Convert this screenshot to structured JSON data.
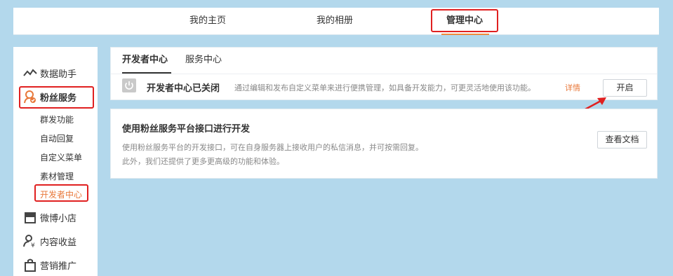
{
  "topnav": {
    "home": "我的主页",
    "album": "我的相册",
    "admin": "管理中心"
  },
  "sidebar": {
    "data_assistant": "数据助手",
    "fans_service": "粉丝服务",
    "fans_sub": [
      "群发功能",
      "自动回复",
      "自定义菜单",
      "素材管理",
      "开发者中心"
    ],
    "weibo_shop": "微博小店",
    "content_income": "内容收益",
    "marketing": "营销推广"
  },
  "panel1": {
    "tab_dev": "开发者中心",
    "tab_service": "服务中心",
    "dev_status": "开发者中心已关闭",
    "dev_desc": "通过编辑和发布自定义菜单来进行便携管理，如具备开发能力，可更灵活地使用该功能。",
    "dev_link": "详情",
    "open_button": "开启"
  },
  "panel2": {
    "title": "使用粉丝服务平台接口进行开发",
    "desc": "使用粉丝服务平台的开发接口，可在自身服务器上接收用户的私信消息，并可按需回复。此外，我们还提供了更多更高级的功能和体验。",
    "doc_button": "查看文档"
  },
  "colors": {
    "background": "#b3d8ec",
    "highlight_red": "#e02020",
    "link_orange": "#e8783a",
    "active_sidebar": "#e8783a"
  },
  "icons": [
    "chart-line-icon",
    "fans-service-icon",
    "shop-icon",
    "person-yen-icon",
    "bag-icon",
    "power-icon",
    "arrow-annotation"
  ]
}
